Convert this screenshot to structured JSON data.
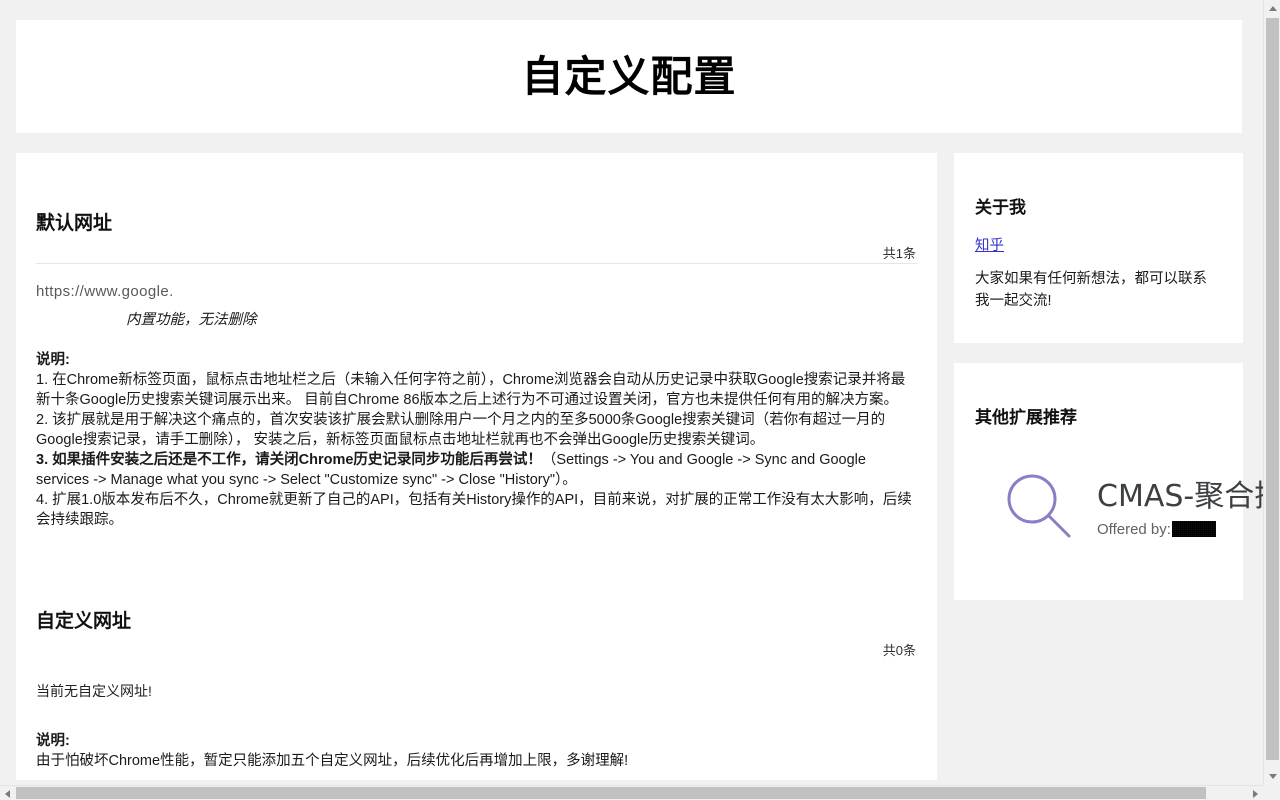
{
  "page": {
    "title": "自定义配置",
    "background_color": "#f1f1f1",
    "card_color": "#ffffff"
  },
  "default_url_section": {
    "heading": "默认网址",
    "count_label": "共1条",
    "items": [
      {
        "url": "https://www.google.",
        "note": "内置功能，无法删除"
      }
    ],
    "description": {
      "title": "说明:",
      "lines": [
        "1. 在Chrome新标签页面，鼠标点击地址栏之后（未输入任何字符之前），Chrome浏览器会自动从历史记录中获取Google搜索记录并将最新十条Google历史搜索关键词展示出来。 目前自Chrome 86版本之后上述行为不可通过设置关闭，官方也未提供任何有用的解决方案。",
        "2. 该扩展就是用于解决这个痛点的，首次安装该扩展会默认删除用户一个月之内的至多5000条Google搜索关键词（若你有超过一月的Google搜索记录，请手工删除）， 安装之后，新标签页面鼠标点击地址栏就再也不会弹出Google历史搜索关键词。",
        "3. 如果插件安装之后还是不工作，请关闭Chrome历史记录同步功能后再尝试！",
        "4. 扩展1.0版本发布后不久，Chrome就更新了自己的API，包括有关History操作的API，目前来说，对扩展的正常工作没有太大影响，后续会持续跟踪。"
      ],
      "line3_bold": "3. 如果插件安装之后还是不工作，请关闭Chrome历史记录同步功能后再尝试！",
      "line3_tail": "（Settings -> You and Google -> Sync and Google services -> Manage what you sync -> Select \"Customize sync\" -> Close \"History\"）。"
    }
  },
  "custom_url_section": {
    "heading": "自定义网址",
    "count_label": "共0条",
    "empty_text": "当前无自定义网址!",
    "description": {
      "title": "说明:",
      "text": "由于怕破坏Chrome性能，暂定只能添加五个自定义网址，后续优化后再增加上限，多谢理解!"
    }
  },
  "sidebar": {
    "about": {
      "heading": "关于我",
      "link_label": "知乎",
      "link_color": "#3333cc",
      "text": "大家如果有任何新想法，都可以联系我一起交流!"
    },
    "recommend": {
      "heading": "其他扩展推荐",
      "items": [
        {
          "icon": "magnifier-icon",
          "icon_color": "#8a7fc4",
          "name": "CMAS-聚合搜",
          "offered_by_label": "Offered by:",
          "offered_by_value": ""
        }
      ]
    }
  },
  "scrollbars": {
    "vertical_up_icon": "caret-up-icon",
    "vertical_down_icon": "caret-down-icon",
    "horizontal_left_icon": "caret-left-icon",
    "horizontal_right_icon": "caret-right-icon"
  }
}
